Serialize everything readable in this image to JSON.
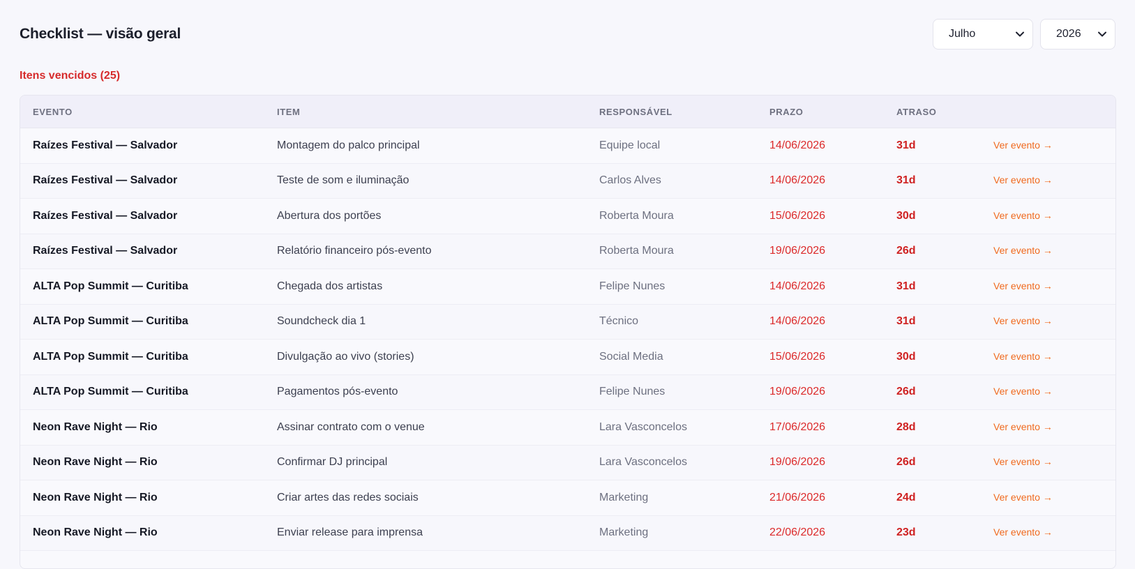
{
  "header": {
    "title": "Checklist — visão geral",
    "month_select": {
      "value": "Julho"
    },
    "year_select": {
      "value": "2026"
    }
  },
  "section": {
    "title": "Itens vencidos (25)"
  },
  "table": {
    "columns": [
      "EVENTO",
      "ITEM",
      "RESPONSÁVEL",
      "PRAZO",
      "ATRASO"
    ],
    "link_label": "Ver evento →",
    "rows": [
      {
        "evento": "Raízes Festival — Salvador",
        "item": "Montagem do palco principal",
        "responsavel": "Equipe local",
        "prazo": "14/06/2026",
        "atraso": "31d"
      },
      {
        "evento": "Raízes Festival — Salvador",
        "item": "Teste de som e iluminação",
        "responsavel": "Carlos Alves",
        "prazo": "14/06/2026",
        "atraso": "31d"
      },
      {
        "evento": "Raízes Festival — Salvador",
        "item": "Abertura dos portões",
        "responsavel": "Roberta Moura",
        "prazo": "15/06/2026",
        "atraso": "30d"
      },
      {
        "evento": "Raízes Festival — Salvador",
        "item": "Relatório financeiro pós-evento",
        "responsavel": "Roberta Moura",
        "prazo": "19/06/2026",
        "atraso": "26d"
      },
      {
        "evento": "ALTA Pop Summit — Curitiba",
        "item": "Chegada dos artistas",
        "responsavel": "Felipe Nunes",
        "prazo": "14/06/2026",
        "atraso": "31d"
      },
      {
        "evento": "ALTA Pop Summit — Curitiba",
        "item": "Soundcheck dia 1",
        "responsavel": "Técnico",
        "prazo": "14/06/2026",
        "atraso": "31d"
      },
      {
        "evento": "ALTA Pop Summit — Curitiba",
        "item": "Divulgação ao vivo (stories)",
        "responsavel": "Social Media",
        "prazo": "15/06/2026",
        "atraso": "30d"
      },
      {
        "evento": "ALTA Pop Summit — Curitiba",
        "item": "Pagamentos pós-evento",
        "responsavel": "Felipe Nunes",
        "prazo": "19/06/2026",
        "atraso": "26d"
      },
      {
        "evento": "Neon Rave Night — Rio",
        "item": "Assinar contrato com o venue",
        "responsavel": "Lara Vasconcelos",
        "prazo": "17/06/2026",
        "atraso": "28d"
      },
      {
        "evento": "Neon Rave Night — Rio",
        "item": "Confirmar DJ principal",
        "responsavel": "Lara Vasconcelos",
        "prazo": "19/06/2026",
        "atraso": "26d"
      },
      {
        "evento": "Neon Rave Night — Rio",
        "item": "Criar artes das redes sociais",
        "responsavel": "Marketing",
        "prazo": "21/06/2026",
        "atraso": "24d"
      },
      {
        "evento": "Neon Rave Night — Rio",
        "item": "Enviar release para imprensa",
        "responsavel": "Marketing",
        "prazo": "22/06/2026",
        "atraso": "23d"
      }
    ]
  }
}
